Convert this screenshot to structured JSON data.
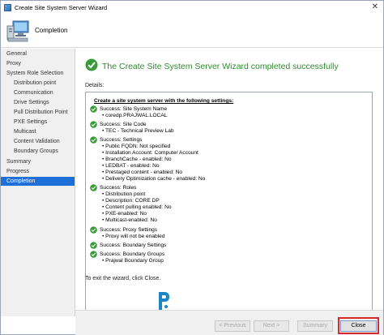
{
  "window": {
    "title": "Create Site System Server Wizard"
  },
  "header": {
    "title": "Completion"
  },
  "sidebar": {
    "items": [
      {
        "label": "General",
        "sub": false,
        "active": false
      },
      {
        "label": "Proxy",
        "sub": false,
        "active": false
      },
      {
        "label": "System Role Selection",
        "sub": false,
        "active": false
      },
      {
        "label": "Distribution point",
        "sub": true,
        "active": false
      },
      {
        "label": "Communication",
        "sub": true,
        "active": false
      },
      {
        "label": "Drive Settings",
        "sub": true,
        "active": false
      },
      {
        "label": "Pull Distribution Point",
        "sub": true,
        "active": false
      },
      {
        "label": "PXE Settings",
        "sub": true,
        "active": false
      },
      {
        "label": "Multicast",
        "sub": true,
        "active": false
      },
      {
        "label": "Content Validation",
        "sub": true,
        "active": false
      },
      {
        "label": "Boundary Groups",
        "sub": true,
        "active": false
      },
      {
        "label": "Summary",
        "sub": false,
        "active": false
      },
      {
        "label": "Progress",
        "sub": false,
        "active": false
      },
      {
        "label": "Completion",
        "sub": false,
        "active": true
      }
    ]
  },
  "main": {
    "success_title": "The Create Site System Server Wizard completed successfully",
    "details_label": "Details:",
    "details_heading": "Create a site system server with the following settings:",
    "sections": [
      {
        "title": "Success: Site System Name",
        "lines": [
          "coredp.PRAJWAL.LOCAL"
        ]
      },
      {
        "title": "Success: Site Code",
        "lines": [
          "TEC - Technical Preview Lab"
        ]
      },
      {
        "title": "Success: Settings",
        "lines": [
          "Public FQDN: Not specified",
          "Installation Account: Computer Account",
          "BranchCache - enabled:  No",
          "LEDBAT - enabled:  No",
          "Prestaged content - enabled:  No",
          "Delivery Optimization cache - enabled:  No"
        ]
      },
      {
        "title": "Success: Roles",
        "lines": [
          "Distribution point",
          "Description: CORE DP",
          "Content pulling enabled: No",
          "PXE-enabled: No",
          "Multicast-enabled: No"
        ]
      },
      {
        "title": "Success: Proxy Settings",
        "lines": [
          "Proxy will not be enabled"
        ]
      },
      {
        "title": "Success: Boundary Settings",
        "lines": []
      },
      {
        "title": "Success: Boundary Groups",
        "lines": [
          "Prajwal Boundary Group"
        ]
      }
    ],
    "exit_text": "To exit the wizard, click Close."
  },
  "buttons": {
    "previous": "< Previous",
    "next": "Next >",
    "summary": "Summary",
    "close": "Close"
  },
  "colors": {
    "accent": "#1e6fd8",
    "success": "#2f8b2f",
    "highlight": "#d62a2a"
  }
}
